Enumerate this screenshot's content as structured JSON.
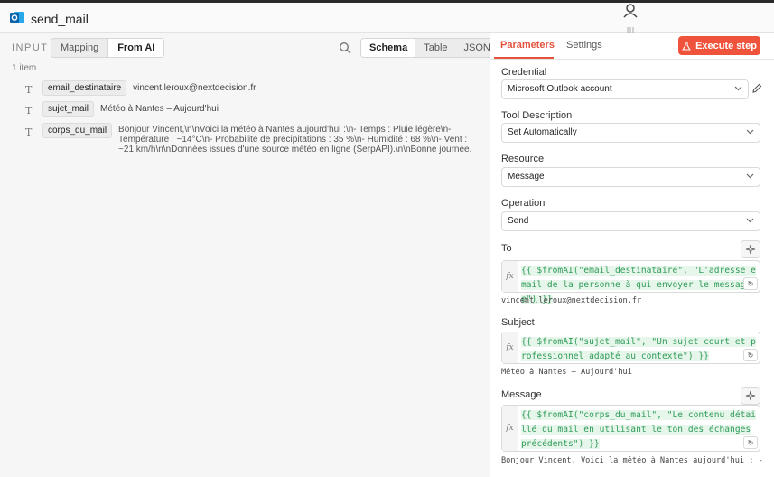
{
  "window": {
    "title": "send_mail"
  },
  "input_panel": {
    "label": "INPUT",
    "mode_tabs": [
      {
        "label": "Mapping",
        "active": false
      },
      {
        "label": "From AI",
        "active": true
      }
    ],
    "view_tabs": [
      {
        "label": "Schema",
        "active": true
      },
      {
        "label": "Table",
        "active": false
      },
      {
        "label": "JSON",
        "active": false
      }
    ],
    "item_count": "1 item",
    "fields": [
      {
        "type_icon": "T",
        "key": "email_destinataire",
        "value": "vincent.leroux@nextdecision.fr"
      },
      {
        "type_icon": "T",
        "key": "sujet_mail",
        "value": "Météo à Nantes – Aujourd'hui"
      },
      {
        "type_icon": "T",
        "key": "corps_du_mail",
        "value": "Bonjour Vincent,\\n\\nVoici la météo à Nantes aujourd'hui :\\n- Temps : Pluie légère\\n- Température : ~14°C\\n- Probabilité de précipitations : 35 %\\n- Humidité : 68 %\\n- Vent : ~21 km/h\\n\\nDonnées issues d'une source météo en ligne (SerpAPI).\\n\\nBonne journée."
      }
    ]
  },
  "params_panel": {
    "tabs": [
      {
        "label": "Parameters",
        "active": true
      },
      {
        "label": "Settings",
        "active": false
      }
    ],
    "execute_label": "Execute step",
    "credential": {
      "label": "Credential",
      "value": "Microsoft Outlook account"
    },
    "tool_description": {
      "label": "Tool Description",
      "value": "Set Automatically"
    },
    "resource": {
      "label": "Resource",
      "value": "Message"
    },
    "operation": {
      "label": "Operation",
      "value": "Send"
    },
    "to": {
      "label": "To",
      "expression": "{{ $fromAI(\"email_destinataire\", \"L'adresse email de la personne à qui envoyer le message\") }}",
      "result": "vincent.leroux@nextdecision.fr"
    },
    "subject": {
      "label": "Subject",
      "expression": "{{ $fromAI(\"sujet_mail\", \"Un sujet court et professionnel adapté au contexte\") }}",
      "result": "Météo à Nantes – Aujourd'hui"
    },
    "message": {
      "label": "Message",
      "expression": "{{ $fromAI(\"corps_du_mail\", \"Le contenu détaillé du mail en utilisant le ton des échanges précédents\") }}",
      "result": "Bonjour Vincent, Voici la météo à Nantes aujourd'hui : - Temps"
    }
  },
  "colors": {
    "accent": "#f0533b",
    "code_green": "#2f9b5a"
  },
  "icons": [
    "outlook-app-icon",
    "user-icon",
    "grip-icon",
    "search-icon",
    "text-type-icon",
    "chevron-down-icon",
    "pencil-icon",
    "sparkle-icon",
    "undo-icon",
    "flask-icon"
  ]
}
